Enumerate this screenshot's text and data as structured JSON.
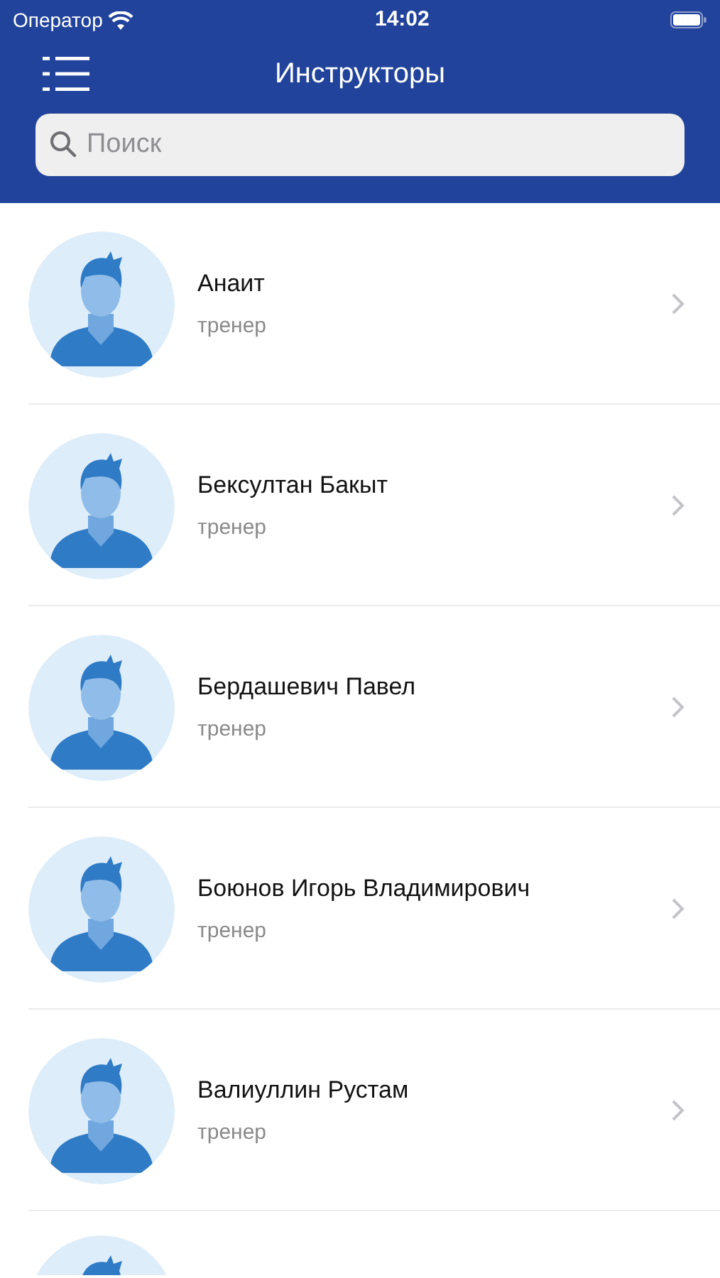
{
  "status_bar": {
    "carrier": "Оператор",
    "time": "14:02"
  },
  "nav": {
    "title": "Инструкторы"
  },
  "search": {
    "placeholder": "Поиск"
  },
  "instructors": [
    {
      "kind": "person",
      "name": "Анаит",
      "role": "тренер"
    },
    {
      "kind": "person",
      "name": "Бексултан Бакыт",
      "role": "тренер"
    },
    {
      "kind": "person",
      "name": "Бердашевич Павел",
      "role": "тренер"
    },
    {
      "kind": "person",
      "name": "Боюнов Игорь Владимирович",
      "role": "тренер"
    },
    {
      "kind": "person",
      "name": "Валиуллин Рустам",
      "role": "тренер"
    },
    {
      "kind": "avatar_only"
    }
  ]
}
